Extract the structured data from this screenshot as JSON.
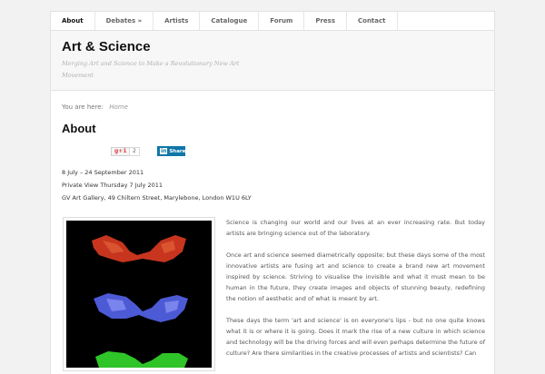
{
  "nav": {
    "items": [
      {
        "label": "About"
      },
      {
        "label": "Debates »"
      },
      {
        "label": "Artists"
      },
      {
        "label": "Catalogue"
      },
      {
        "label": "Forum"
      },
      {
        "label": "Press"
      },
      {
        "label": "Contact"
      }
    ],
    "active_index": 0
  },
  "header": {
    "title": "Art & Science",
    "description": "Merging Art and Science to Make a Revolutionary New Art Movement"
  },
  "breadcrumb": {
    "prefix": "You are here:",
    "home": "Home"
  },
  "page_title": "About",
  "share": {
    "gplus_label": "+1",
    "gplus_count": "2",
    "linkedin_label": "Share",
    "linkedin_icon": "linkedin-icon",
    "linkedin_icon_text": "in"
  },
  "event": {
    "dates": "8 July – 24 September 2011",
    "private_view": "Private View Thursday 7 July  2011",
    "venue": "GV Art Gallery, 49 Chiltern Street, Marylebone, London W1U 6LY"
  },
  "article": {
    "paragraphs": [
      "Science is changing our world and our lives at an ever increasing rate. But today artists are bringing science out of the laboratory.",
      "Once art and science seemed diametrically opposite; but these days some of the most innovative artists are fusing art and science to create a brand new art movement inspired by science. Striving to visualise the invisible and what it must mean to be human in the future,  they create images and objects of stunning beauty, redefining the notion of aesthetic and of what is meant by art.",
      "These days the term 'art and science' is on everyone's lips - but no one quite knows what it is or where it is going. Does it mark the rise of a new culture in which science and technology will be the driving forces and will even perhaps determine the future of culture? Are there similarities in the creative processes of artists and scientists? Can"
    ]
  },
  "colors": {
    "linkedin": "#0e76a8",
    "gplus": "#dd4b39",
    "figure_red": "#c7351f",
    "figure_blue": "#4d5ad6",
    "figure_green": "#2fc427"
  }
}
